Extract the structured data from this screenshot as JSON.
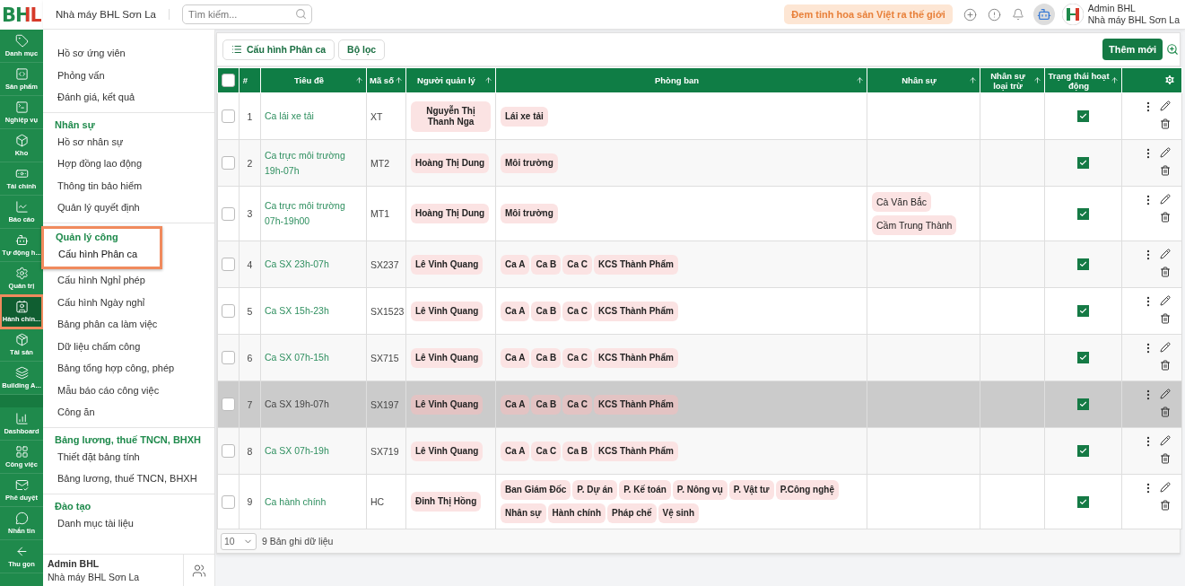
{
  "logo": "BHL",
  "rail": {
    "items": [
      {
        "label": "Danh mục",
        "selected": false
      },
      {
        "label": "Sản phẩm",
        "selected": false
      },
      {
        "label": "Nghiệp vụ",
        "selected": false
      },
      {
        "label": "Kho",
        "selected": false
      },
      {
        "label": "Tài chính",
        "selected": false
      },
      {
        "label": "Báo cáo",
        "selected": false
      },
      {
        "label": "Tự động h...",
        "selected": false
      },
      {
        "label": "Quản trị",
        "selected": false
      },
      {
        "label": "Hành chín...",
        "selected": true
      },
      {
        "label": "Tài sản",
        "selected": false
      },
      {
        "label": "Building A...",
        "selected": false
      }
    ],
    "bottom_items": [
      {
        "label": "Dashboard"
      },
      {
        "label": "Công việc"
      },
      {
        "label": "Phê duyệt"
      },
      {
        "label": "Nhắn tin"
      },
      {
        "label": "Thu gọn"
      }
    ]
  },
  "topbar": {
    "company": "Nhà máy BHL Sơn La",
    "search": {
      "placeholder": "Tìm kiếm..."
    },
    "slogan": "Đem tinh hoa sản Việt ra thế giới",
    "user": {
      "name": "Admin BHL",
      "org": "Nhà máy BHL Sơn La"
    }
  },
  "menu": {
    "sections": [
      {
        "items": [
          {
            "label": "Hồ sơ ứng viên",
            "selected": false
          },
          {
            "label": "Phỏng vấn",
            "selected": false
          },
          {
            "label": "Đánh giá, kết quả",
            "selected": false
          }
        ]
      },
      {
        "title": "Nhân sự",
        "highlighted": false,
        "items": [
          {
            "label": "Hồ sơ nhân sự",
            "selected": false
          },
          {
            "label": "Hợp đồng lao động",
            "selected": false
          },
          {
            "label": "Thông tin bảo hiểm",
            "selected": false
          },
          {
            "label": "Quản lý quyết định",
            "selected": false
          }
        ]
      },
      {
        "title": "Quản lý công",
        "highlighted": true,
        "items": [
          {
            "label": "Cấu hình Phân ca",
            "selected": true
          },
          {
            "label": "Cấu hình Nghỉ phép",
            "selected": false
          },
          {
            "label": "Cấu hình Ngày nghỉ",
            "selected": false
          },
          {
            "label": "Bảng phân ca làm việc",
            "selected": false
          },
          {
            "label": "Dữ liệu chấm công",
            "selected": false
          },
          {
            "label": "Bảng tổng hợp công, phép",
            "selected": false
          },
          {
            "label": "Mẫu báo cáo công việc",
            "selected": false
          },
          {
            "label": "Công ăn",
            "selected": false
          }
        ]
      },
      {
        "title": "Bảng lương, thuế TNCN, BHXH",
        "highlighted": false,
        "items": [
          {
            "label": "Thiết đặt bảng tính",
            "selected": false
          },
          {
            "label": "Bảng lương, thuế TNCN, BHXH",
            "selected": false
          }
        ]
      },
      {
        "title": "Đào tạo",
        "highlighted": false,
        "items": [
          {
            "label": "Danh mục tài liệu",
            "selected": false
          }
        ]
      }
    ],
    "footer": {
      "name": "Admin BHL",
      "org": "Nhà máy BHL Sơn La"
    }
  },
  "toolbar": {
    "view_button": "Cấu hình Phân ca",
    "filter_button": "Bộ lọc",
    "add_button": "Thêm mới"
  },
  "table": {
    "columns": [
      {
        "kind": "checkbox",
        "checked": false
      },
      {
        "kind": "text",
        "label": "#",
        "sortable": false
      },
      {
        "kind": "text",
        "label": "Tiêu đề",
        "sortable": true
      },
      {
        "kind": "text",
        "label": "Mã số",
        "sortable": true
      },
      {
        "kind": "text",
        "label": "Người quản lý",
        "sortable": true
      },
      {
        "kind": "text",
        "label": "Phòng ban",
        "sortable": true
      },
      {
        "kind": "text",
        "label": "Nhân sự",
        "sortable": true
      },
      {
        "kind": "text",
        "label": "Nhân sự loại trừ",
        "sortable": true
      },
      {
        "kind": "text",
        "label": "Trạng thái hoạt động",
        "sortable": true
      },
      {
        "kind": "settings"
      }
    ],
    "rows": [
      {
        "checked": false,
        "selected": false,
        "no": "1",
        "title": "Ca lái xe tải",
        "code": "XT",
        "manager": "Nguyễn Thị Thanh Nga",
        "departments": [
          "Lái xe tải"
        ],
        "staff": [],
        "active": true
      },
      {
        "checked": false,
        "selected": false,
        "no": "2",
        "title": "Ca trực môi trường 19h-07h",
        "code": "MT2",
        "manager": "Hoàng Thị Dung",
        "departments": [
          "Môi trường"
        ],
        "staff": [],
        "active": true
      },
      {
        "checked": false,
        "selected": false,
        "no": "3",
        "title": "Ca trực môi trường 07h-19h00",
        "code": "MT1",
        "manager": "Hoàng Thị Dung",
        "departments": [
          "Môi trường"
        ],
        "staff": [
          "Cà Văn Bắc",
          "Cầm Trung Thành"
        ],
        "active": true
      },
      {
        "checked": false,
        "selected": false,
        "no": "4",
        "title": "Ca SX 23h-07h",
        "code": "SX237",
        "manager": "Lê Vinh Quang",
        "departments": [
          "Ca A",
          "Ca B",
          "Ca C",
          "KCS Thành Phẩm"
        ],
        "staff": [],
        "active": true
      },
      {
        "checked": false,
        "selected": false,
        "no": "5",
        "title": "Ca SX 15h-23h",
        "code": "SX1523",
        "manager": "Lê Vinh Quang",
        "departments": [
          "Ca A",
          "Ca B",
          "Ca C",
          "KCS Thành Phẩm"
        ],
        "staff": [],
        "active": true
      },
      {
        "checked": false,
        "selected": false,
        "no": "6",
        "title": "Ca SX 07h-15h",
        "code": "SX715",
        "manager": "Lê Vinh Quang",
        "departments": [
          "Ca A",
          "Ca B",
          "Ca C",
          "KCS Thành Phẩm"
        ],
        "staff": [],
        "active": true
      },
      {
        "checked": false,
        "selected": true,
        "no": "7",
        "title": "Ca SX 19h-07h",
        "code": "SX197",
        "manager": "Lê Vinh Quang",
        "departments": [
          "Ca A",
          "Ca B",
          "Ca C",
          "KCS Thành Phẩm"
        ],
        "staff": [],
        "active": true
      },
      {
        "checked": false,
        "selected": false,
        "no": "8",
        "title": "Ca SX 07h-19h",
        "code": "SX719",
        "manager": "Lê Vinh Quang",
        "departments": [
          "Ca A",
          "Ca C",
          "Ca B",
          "KCS Thành Phẩm"
        ],
        "staff": [],
        "active": true
      },
      {
        "checked": false,
        "selected": false,
        "no": "9",
        "title": "Ca hành chính",
        "code": "HC",
        "manager": "Đinh Thị Hồng",
        "departments": [
          "Ban Giám Đốc",
          "P. Dự án",
          "P. Kế toán",
          "P. Nông vụ",
          "P. Vật tư",
          "P.Công nghệ",
          "Nhân sự",
          "Hành chính",
          "Pháp chế",
          "Vệ sinh"
        ],
        "staff": [],
        "active": true
      }
    ],
    "footer": {
      "page_size": "10",
      "count": "9 Bản ghi dữ liệu"
    }
  }
}
